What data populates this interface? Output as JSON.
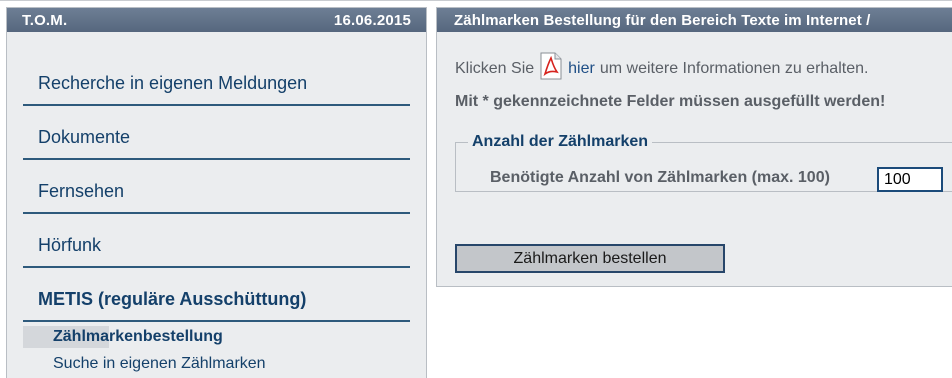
{
  "left_panel": {
    "title": "T.O.M.",
    "date": "16.06.2015",
    "nav_items": [
      {
        "label": "Recherche in eigenen Meldungen"
      },
      {
        "label": "Dokumente"
      },
      {
        "label": "Fernsehen"
      },
      {
        "label": "Hörfunk"
      },
      {
        "label": "METIS (reguläre Ausschüttung)"
      }
    ],
    "sub_items": [
      {
        "label": "Zählmarkenbestellung"
      },
      {
        "label": "Suche in eigenen Zählmarken"
      }
    ]
  },
  "right_panel": {
    "title": "Zählmarken Bestellung für den Bereich Texte im Internet /",
    "info_prefix": "Klicken Sie",
    "info_link": "hier",
    "info_suffix": "um weitere Informationen zu erhalten.",
    "required_note": "Mit * gekennzeichnete Felder müssen ausgefüllt werden!",
    "fieldset_legend": "Anzahl der Zählmarken",
    "field_label": "Benötigte Anzahl von Zählmarken (max. 100)",
    "field_value": "100",
    "order_button": "Zählmarken bestellen",
    "pdf_icon": "pdf-file-icon"
  },
  "colors": {
    "header": "#5f7088",
    "nav_text": "#14406a",
    "panel_bg": "#ebedef"
  }
}
